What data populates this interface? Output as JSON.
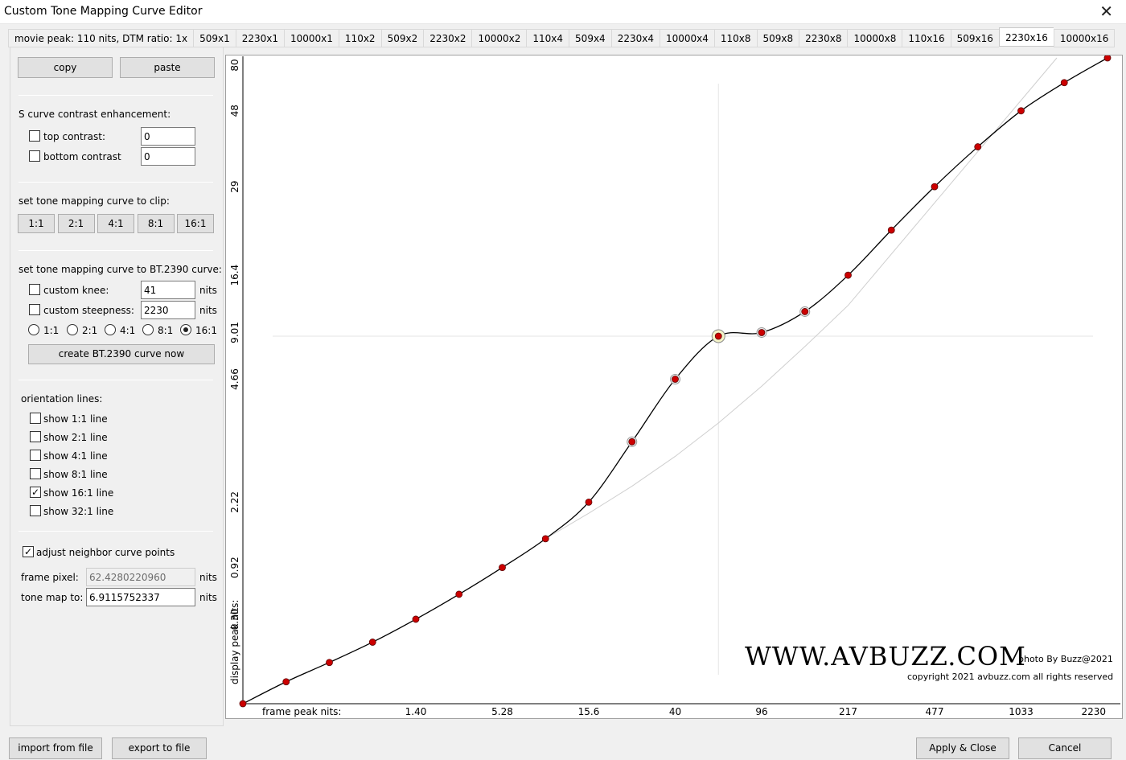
{
  "window": {
    "title": "Custom Tone Mapping Curve Editor"
  },
  "tabs": [
    {
      "label": "movie peak: 110 nits, DTM ratio: 1x",
      "active": false
    },
    {
      "label": "509x1",
      "active": false
    },
    {
      "label": "2230x1",
      "active": false
    },
    {
      "label": "10000x1",
      "active": false
    },
    {
      "label": "110x2",
      "active": false
    },
    {
      "label": "509x2",
      "active": false
    },
    {
      "label": "2230x2",
      "active": false
    },
    {
      "label": "10000x2",
      "active": false
    },
    {
      "label": "110x4",
      "active": false
    },
    {
      "label": "509x4",
      "active": false
    },
    {
      "label": "2230x4",
      "active": false
    },
    {
      "label": "10000x4",
      "active": false
    },
    {
      "label": "110x8",
      "active": false
    },
    {
      "label": "509x8",
      "active": false
    },
    {
      "label": "2230x8",
      "active": false
    },
    {
      "label": "10000x8",
      "active": false
    },
    {
      "label": "110x16",
      "active": false
    },
    {
      "label": "509x16",
      "active": false
    },
    {
      "label": "2230x16",
      "active": true
    },
    {
      "label": "10000x16",
      "active": false
    }
  ],
  "panel": {
    "copy": "copy",
    "paste": "paste",
    "s_curve_title": "S curve contrast enhancement:",
    "top_contrast_label": "top contrast:",
    "top_contrast_value": "0",
    "bottom_contrast_label": "bottom contrast",
    "bottom_contrast_value": "0",
    "clip_title": "set tone mapping curve to clip:",
    "clip_buttons": [
      "1:1",
      "2:1",
      "4:1",
      "8:1",
      "16:1"
    ],
    "bt_title": "set tone mapping curve to BT.2390 curve:",
    "custom_knee_label": "custom knee:",
    "custom_knee_value": "41",
    "custom_steepness_label": "custom steepness:",
    "custom_steepness_value": "2230",
    "nits": "nits",
    "ratios": [
      "1:1",
      "2:1",
      "4:1",
      "8:1",
      "16:1"
    ],
    "ratio_selected": "16:1",
    "create_button": "create BT.2390 curve now",
    "orientation_title": "orientation lines:",
    "orientation": [
      {
        "label": "show 1:1 line",
        "checked": false
      },
      {
        "label": "show 2:1 line",
        "checked": false
      },
      {
        "label": "show 4:1 line",
        "checked": false
      },
      {
        "label": "show 8:1 line",
        "checked": false
      },
      {
        "label": "show 16:1 line",
        "checked": true
      },
      {
        "label": "show 32:1 line",
        "checked": false
      }
    ],
    "adjust_label": "adjust neighbor curve points",
    "adjust_checked": true,
    "frame_pixel_label": "frame pixel:",
    "frame_pixel_value": "62.4280220960",
    "tone_map_label": "tone map to:",
    "tone_map_value": "6.9115752337"
  },
  "footer": {
    "import": "import from file",
    "export": "export to file",
    "apply": "Apply & Close",
    "cancel": "Cancel"
  },
  "watermark": {
    "site": "WWW.AVBUZZ.COM",
    "credit": "photo By Buzz@2021",
    "copyright": "copyright 2021 avbuzz.com all rights reserved"
  },
  "chart_data": {
    "type": "line",
    "xlabel": "frame peak nits:",
    "ylabel": "display peak nits:",
    "x_ticks": [
      "1.40",
      "5.28",
      "15.6",
      "40",
      "96",
      "217",
      "477",
      "1033",
      "2230"
    ],
    "y_ticks": [
      "80",
      "48",
      "29",
      "16.4",
      "9.01",
      "4.66",
      "2.22",
      "0.92",
      "0.30"
    ],
    "curve_color": "#000000",
    "point_color": "#cc0000",
    "selected_point": {
      "x": 62.428,
      "y": 6.9116
    },
    "points": [
      {
        "i": 0,
        "v": 0.0
      },
      {
        "i": 1,
        "v": 1.09
      },
      {
        "i": 2,
        "v": 2.05
      },
      {
        "i": 3,
        "v": 3.06
      },
      {
        "i": 4,
        "v": 4.2
      },
      {
        "i": 5,
        "v": 5.44
      },
      {
        "i": 6,
        "v": 6.77
      },
      {
        "i": 7,
        "v": 8.2
      },
      {
        "i": 8,
        "v": 10.02
      },
      {
        "i": 9,
        "v": 13.02
      },
      {
        "i": 10,
        "v": 16.13
      },
      {
        "i": 11,
        "v": 18.27
      },
      {
        "i": 12,
        "v": 18.45
      },
      {
        "i": 13,
        "v": 19.49
      },
      {
        "i": 14,
        "v": 21.3
      },
      {
        "i": 15,
        "v": 23.54
      },
      {
        "i": 16,
        "v": 25.7
      },
      {
        "i": 17,
        "v": 27.68
      },
      {
        "i": 18,
        "v": 29.47
      },
      {
        "i": 19,
        "v": 30.87
      },
      {
        "i": 20,
        "v": 32.1
      }
    ],
    "reference_line": {
      "label": "16:1",
      "color": "#c8c8c8"
    },
    "grid": false
  }
}
